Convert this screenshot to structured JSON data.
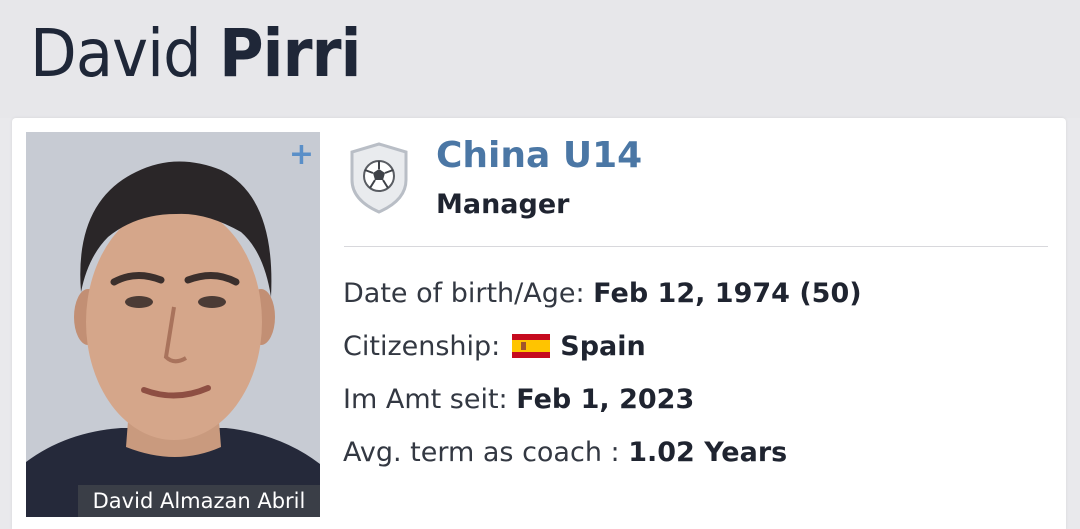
{
  "profile": {
    "first_name": "David",
    "last_name": "Pirri"
  },
  "photo": {
    "caption": "David Almazan Abril",
    "add_symbol": "+"
  },
  "club": {
    "name": "China U14",
    "role": "Manager"
  },
  "info": {
    "dob_label": "Date of birth/Age:",
    "dob_value": "Feb 12, 1974 (50)",
    "citizenship_label": "Citizenship:",
    "citizenship_value": "Spain",
    "in_office_label": "Im Amt seit:",
    "in_office_value": "Feb 1, 2023",
    "avg_term_label": "Avg. term as coach :",
    "avg_term_value": "1.02 Years"
  },
  "icons": {
    "club_badge": "soccer-ball-shield-icon",
    "flag": "spain-flag-icon",
    "add": "plus-icon"
  },
  "colors": {
    "accent_blue": "#4b77a5",
    "caption_bg": "#3a3e47",
    "header_bg": "#e7e7ea"
  }
}
